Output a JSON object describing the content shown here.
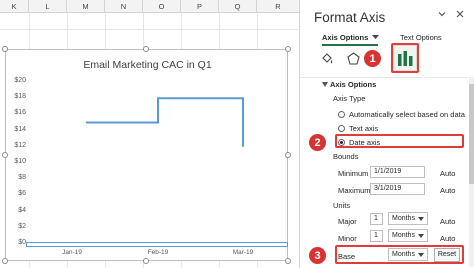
{
  "sheet": {
    "columns": [
      "K",
      "L",
      "M",
      "N",
      "O",
      "P",
      "Q",
      "R"
    ]
  },
  "chart": {
    "title": "Email Marketing CAC in Q1"
  },
  "chart_data": {
    "type": "line",
    "title": "Email Marketing CAC in Q1",
    "xlabel": "",
    "ylabel": "",
    "x_axis_type": "date",
    "x_ticks": [
      "Jan-19",
      "Feb-19",
      "Mar-19"
    ],
    "y_ticks": [
      "$20",
      "$18",
      "$16",
      "$14",
      "$12",
      "$10",
      "$8",
      "$6",
      "$4",
      "$2",
      "$0"
    ],
    "ylim": [
      0,
      20
    ],
    "grid": false,
    "series": [
      {
        "color": "#5b9bd5",
        "points": [
          {
            "x": "2019-01-06",
            "y": 15
          },
          {
            "x": "2019-02-01",
            "y": 15
          },
          {
            "x": "2019-02-01",
            "y": 18
          },
          {
            "x": "2019-03-01",
            "y": 18
          },
          {
            "x": "2019-03-01",
            "y": 12
          }
        ]
      }
    ]
  },
  "pane": {
    "title": "Format Axis",
    "dropdown_icon": "chevron-down",
    "close_icon": "close",
    "tabs": {
      "axis_options": "Axis Options",
      "text_options": "Text Options"
    },
    "section_title": "Axis Options",
    "axis_type_label": "Axis Type",
    "radio_auto": "Automatically select based on data",
    "radio_text": "Text axis",
    "radio_date": "Date axis",
    "bounds_label": "Bounds",
    "minimum_label": "Minimum",
    "minimum_value": "1/1/2019",
    "maximum_label": "Maximum",
    "maximum_value": "3/1/2019",
    "auto_label": "Auto",
    "units_label": "Units",
    "major_label": "Major",
    "major_value": "1",
    "major_unit": "Months",
    "minor_label": "Minor",
    "minor_value": "1",
    "minor_unit": "Months",
    "base_label": "Base",
    "base_unit": "Months",
    "reset_label": "Reset"
  },
  "callouts": {
    "one": "1",
    "two": "2",
    "three": "3",
    "color": "#d83333"
  }
}
